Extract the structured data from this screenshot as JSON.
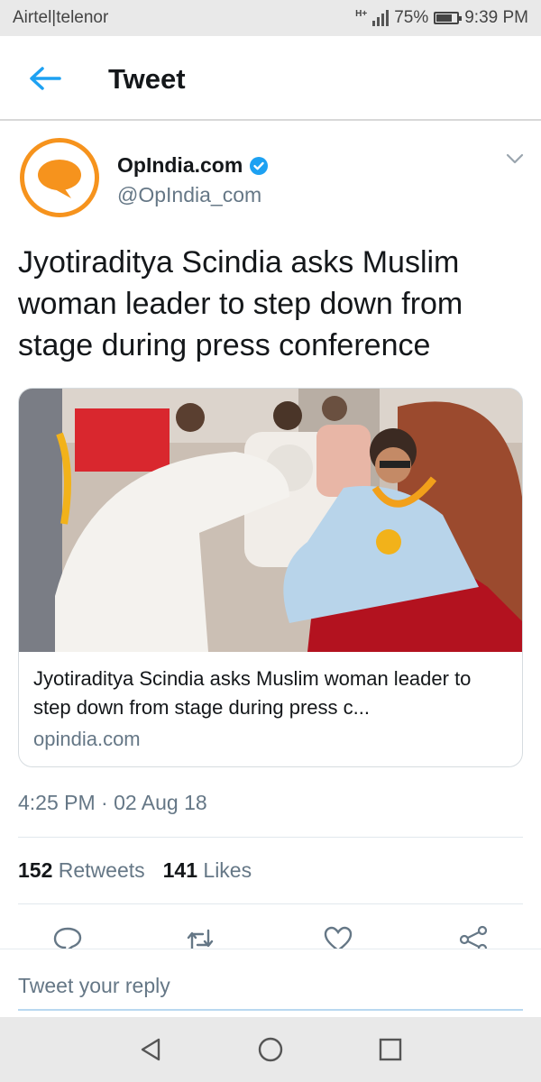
{
  "status_bar": {
    "carrier": "Airtel|telenor",
    "network": "H+",
    "battery": "75%",
    "battery_level": 0.75,
    "time": "9:39 PM"
  },
  "header": {
    "title": "Tweet",
    "back_icon": "arrow-left-icon"
  },
  "author": {
    "name": "OpIndia.com",
    "handle": "@OpIndia_com",
    "verified": true,
    "avatar_color": "#f6931d"
  },
  "tweet": {
    "text": "Jyotiraditya Scindia asks Muslim woman leader to step down from stage during press conference",
    "timestamp": "4:25 PM · 02 Aug 18"
  },
  "card": {
    "title": "Jyotiraditya Scindia asks Muslim woman leader to step down from stage during press c...",
    "domain": "opindia.com"
  },
  "stats": {
    "retweets_count": "152",
    "retweets_label": "Retweets",
    "likes_count": "141",
    "likes_label": "Likes"
  },
  "actions": [
    "reply-icon",
    "retweet-icon",
    "like-icon",
    "share-icon"
  ],
  "reply": {
    "placeholder": "Tweet your reply"
  },
  "nav": [
    "back-triangle-icon",
    "home-circle-icon",
    "recents-square-icon"
  ],
  "colors": {
    "accent": "#1da1f2",
    "text_secondary": "#657786",
    "brand_orange": "#f6931d"
  }
}
